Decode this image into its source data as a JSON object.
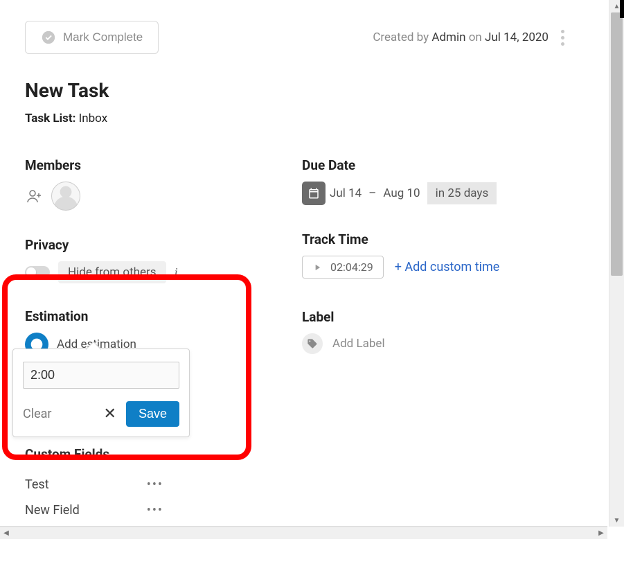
{
  "header": {
    "mark_complete": "Mark Complete",
    "created_by_prefix": "Created by",
    "created_by_user": "Admin",
    "created_on_word": "on",
    "created_date": "Jul 14, 2020"
  },
  "title": "New Task",
  "tasklist": {
    "label": "Task List:",
    "value": "Inbox"
  },
  "members": {
    "title": "Members"
  },
  "privacy": {
    "title": "Privacy",
    "hide_text": "Hide from others"
  },
  "estimation": {
    "title": "Estimation",
    "add_text": "Add estimation",
    "popover": {
      "input_value": "2:00",
      "clear": "Clear",
      "save": "Save"
    }
  },
  "custom_fields": {
    "title": "Custom Fields",
    "rows": [
      {
        "name": "Test"
      },
      {
        "name": "New Field"
      }
    ]
  },
  "due": {
    "title": "Due Date",
    "start": "Jul 14",
    "sep": "–",
    "end": "Aug 10",
    "in_days": "in 25 days"
  },
  "track": {
    "title": "Track Time",
    "value": "02:04:29",
    "add_custom": "+ Add custom time"
  },
  "label": {
    "title": "Label",
    "add_text": "Add Label"
  },
  "dots": "•••"
}
